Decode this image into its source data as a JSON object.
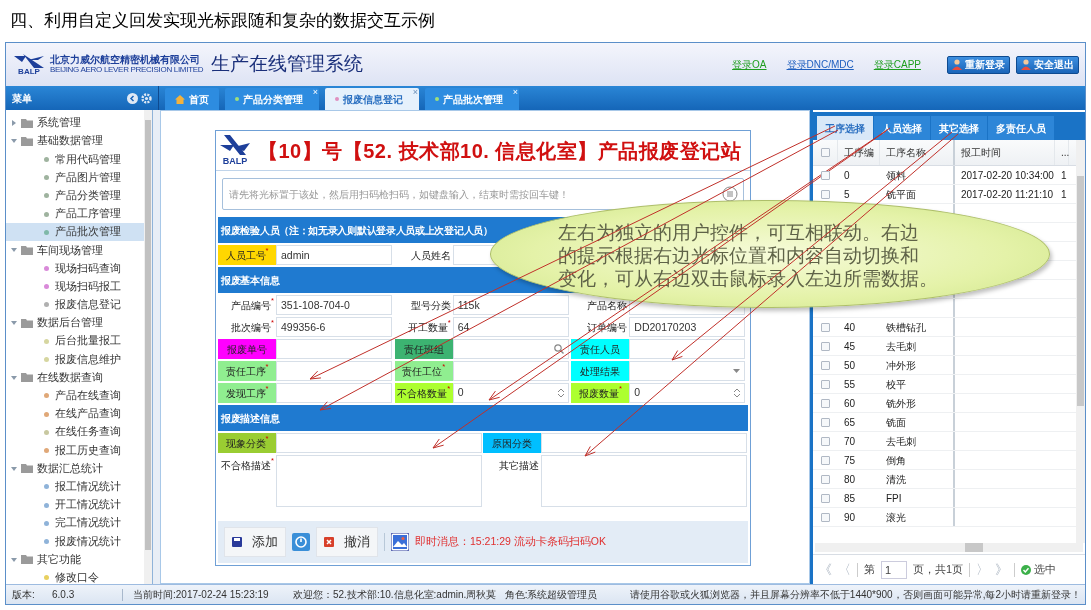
{
  "heading": "四、利用自定义回发实现光标跟随和复杂的数据交互示例",
  "header": {
    "logo_text": "BALP",
    "company_cn": "北京力威尔航空精密机械有限公司",
    "company_en": "BEIJING AERO LEVER PRECISION LIMITED",
    "title": "生产在线管理系统",
    "links": [
      {
        "label": "登录OA",
        "color": "#1f9e1f"
      },
      {
        "label": "登录DNC/MDC",
        "color": "#1f5fbf"
      },
      {
        "label": "登录CAPP",
        "color": "#1f9e1f"
      }
    ],
    "buttons": [
      {
        "label": "重新登录"
      },
      {
        "label": "安全退出"
      }
    ]
  },
  "menu": {
    "title": "菜单"
  },
  "tabs": [
    {
      "label": "首页",
      "kind": "home",
      "selected": false
    },
    {
      "label": "产品分类管理",
      "kind": "page",
      "selected": false,
      "close_mark": "×"
    },
    {
      "label": "报废信息登记",
      "kind": "page",
      "selected": true,
      "close_mark": "×"
    },
    {
      "label": "产品批次管理",
      "kind": "page",
      "selected": false,
      "close_mark": "×"
    }
  ],
  "sidebar": {
    "items": [
      {
        "label": "系统管理",
        "expanded": false
      },
      {
        "label": "基础数据管理",
        "expanded": true,
        "children": [
          {
            "label": "常用代码管理",
            "color": "#9fb39f",
            "selected": false
          },
          {
            "label": "产品图片管理",
            "color": "#9fb39f",
            "selected": false
          },
          {
            "label": "产品分类管理",
            "color": "#9fb39f",
            "selected": false
          },
          {
            "label": "产品工序管理",
            "color": "#9fb39f",
            "selected": false
          },
          {
            "label": "产品批次管理",
            "color": "#7fb8a8",
            "selected": true
          }
        ]
      },
      {
        "label": "车间现场管理",
        "expanded": true,
        "children": [
          {
            "label": "现场扫码查询",
            "color": "#d98ad9",
            "selected": false
          },
          {
            "label": "现场扫码报工",
            "color": "#d98ad9",
            "selected": false
          },
          {
            "label": "报废信息登记",
            "color": "#b0b0b0",
            "selected": false
          }
        ]
      },
      {
        "label": "数据后台管理",
        "expanded": true,
        "children": [
          {
            "label": "后台批量报工",
            "color": "#d6d6a0",
            "selected": false
          },
          {
            "label": "报废信息维护",
            "color": "#d6d6a0",
            "selected": false
          }
        ]
      },
      {
        "label": "在线数据查询",
        "expanded": true,
        "children": [
          {
            "label": "产品在线查询",
            "color": "#e0a878",
            "selected": false
          },
          {
            "label": "在线产品查询",
            "color": "#e0a878",
            "selected": false
          },
          {
            "label": "在线任务查询",
            "color": "#c8c8a0",
            "selected": false
          },
          {
            "label": "报工历史查询",
            "color": "#e0a878",
            "selected": false
          }
        ]
      },
      {
        "label": "数据汇总统计",
        "expanded": true,
        "children": [
          {
            "label": "报工情况统计",
            "color": "#8fb3d9",
            "selected": false
          },
          {
            "label": "开工情况统计",
            "color": "#8fb3d9",
            "selected": false
          },
          {
            "label": "完工情况统计",
            "color": "#8fb3d9",
            "selected": false
          },
          {
            "label": "报废情况统计",
            "color": "#8fb3d9",
            "selected": false
          }
        ]
      },
      {
        "label": "其它功能",
        "expanded": true,
        "children": [
          {
            "label": "修改口令",
            "color": "#e8d060",
            "selected": false
          }
        ]
      }
    ]
  },
  "form": {
    "logo_text": "BALP",
    "title": "【10】号【52. 技术部10. 信息化室】产品报废登记站",
    "scan_placeholder": "请先将光标置于该处，然后用扫码枪扫码，如键盘输入，结束时需按回车键！",
    "sections": [
      {
        "title": "报废检验人员（注：如无录入则默认登录人员或上次登记人员）",
        "rows": [
          [
            {
              "label": "人员工号$^{*}$",
              "color": "#ffd700",
              "kind": "text",
              "value": "admin"
            },
            {
              "label": "人员姓名",
              "kind": "text"
            }
          ]
        ]
      },
      {
        "title": "报废基本信息",
        "rows": [
          [
            {
              "label": "产品编号$^{*}$",
              "kind": "text",
              "value": "351-108-704-0"
            },
            {
              "label": "型号分类",
              "kind": "text",
              "value": "115k"
            },
            {
              "label": "产品名称",
              "kind": "text"
            }
          ],
          [
            {
              "label": "批次编号$^{*}$",
              "kind": "text",
              "value": "499356-6"
            },
            {
              "label": "开工数量$^{*}$",
              "kind": "text",
              "value": "64"
            },
            {
              "label": "订单编号",
              "kind": "text",
              "value": "DD20170203"
            }
          ],
          [
            {
              "label": "报废单号",
              "color": "#ff00ff",
              "kind": "text"
            },
            {
              "label": "责任班组",
              "color": "#3cb371",
              "kind": "search"
            },
            {
              "label": "责任人员",
              "color": "#00ffff",
              "kind": "text"
            }
          ],
          [
            {
              "label": "责任工序$^{*}$",
              "color": "#90ee90",
              "kind": "text"
            },
            {
              "label": "责任工位$^{*}$",
              "color": "#90ee90",
              "kind": "text"
            },
            {
              "label": "处理结果",
              "color": "#00ffff",
              "kind": "select"
            }
          ],
          [
            {
              "label": "发现工序$^{*}$",
              "color": "#90ee90",
              "kind": "text"
            },
            {
              "label": "不合格数量$^{*}$",
              "color": "#adff2f",
              "kind": "number",
              "value": "0"
            },
            {
              "label": "报废数量$^{*}$",
              "color": "#adff2f",
              "kind": "number",
              "value": "0"
            }
          ]
        ]
      },
      {
        "title": "报废描述信息",
        "rows": [
          [
            {
              "label": "现象分类$^{*}$",
              "color": "#9acd32",
              "kind": "text"
            },
            {
              "label": "原因分类",
              "color": "#00bfff",
              "kind": "text"
            }
          ],
          [
            {
              "label": "不合格描述$^{*}$",
              "kind": "textarea"
            },
            {
              "label": "其它描述",
              "kind": "textarea"
            }
          ]
        ]
      }
    ],
    "footer": {
      "add_label": "添加",
      "cancel_label": "撤消",
      "message": "即时消息：15:21:29 流动卡条码扫码OK"
    }
  },
  "callout": {
    "lines": [
      "左右为独立的用户控件，可互相联动。右边",
      "的提示根据右边光标位置和内容自动切换和",
      "变化，可从右边双击鼠标录入左边所需数据。"
    ]
  },
  "right_panel": {
    "tabs": [
      {
        "label": "工序选择",
        "selected": true
      },
      {
        "label": "人员选择",
        "selected": false
      },
      {
        "label": "其它选择",
        "selected": false
      },
      {
        "label": "多责任人员",
        "selected": false
      }
    ],
    "header_checked": false,
    "columns": [
      "工序编",
      "工序名称",
      "报工时间",
      "..."
    ],
    "rows": [
      {
        "code": "0",
        "name": "领料",
        "time": "2017-02-20 10:34:00",
        "column_5": "1",
        "checked": false
      },
      {
        "code": "5",
        "name": "铣平面",
        "time": "2017-02-20 11:21:10",
        "column_5": "1",
        "checked": false
      },
      {},
      {},
      {},
      {},
      {},
      {},
      {
        "code": "40",
        "name": "铁槽钻孔",
        "checked": false
      },
      {
        "code": "45",
        "name": "去毛刺",
        "checked": false
      },
      {
        "code": "50",
        "name": "冲外形",
        "checked": false
      },
      {
        "code": "55",
        "name": "校平",
        "checked": false
      },
      {
        "code": "60",
        "name": "铣外形",
        "checked": false
      },
      {
        "code": "65",
        "name": "铣面",
        "checked": false
      },
      {
        "code": "70",
        "name": "去毛刺",
        "checked": false
      },
      {
        "code": "75",
        "name": "倒角",
        "checked": false
      },
      {
        "code": "80",
        "name": "清洗",
        "checked": false
      },
      {
        "code": "85",
        "name": "FPI",
        "checked": false
      },
      {
        "code": "90",
        "name": "滚光",
        "checked": false
      }
    ],
    "pager": {
      "first": "《",
      "prev": "〈",
      "page_prefix": "第",
      "page": "1",
      "page_suffix": "页，共1页",
      "next": "〉",
      "last": "》",
      "select_label": "选中"
    }
  },
  "status_bar": {
    "version_label": "版本:",
    "version": "6.0.3",
    "time": "当前时间:2017-02-24 15:23:19",
    "welcome": "欢迎您：52.技术部:10.信息化室:admin.周秋莫   角色:系统超级管理员",
    "notice": "请使用谷歌或火狐浏览器，并且屏幕分辨率不低于1440*900，否则画面可能异常,每2小时请重新登录！"
  }
}
